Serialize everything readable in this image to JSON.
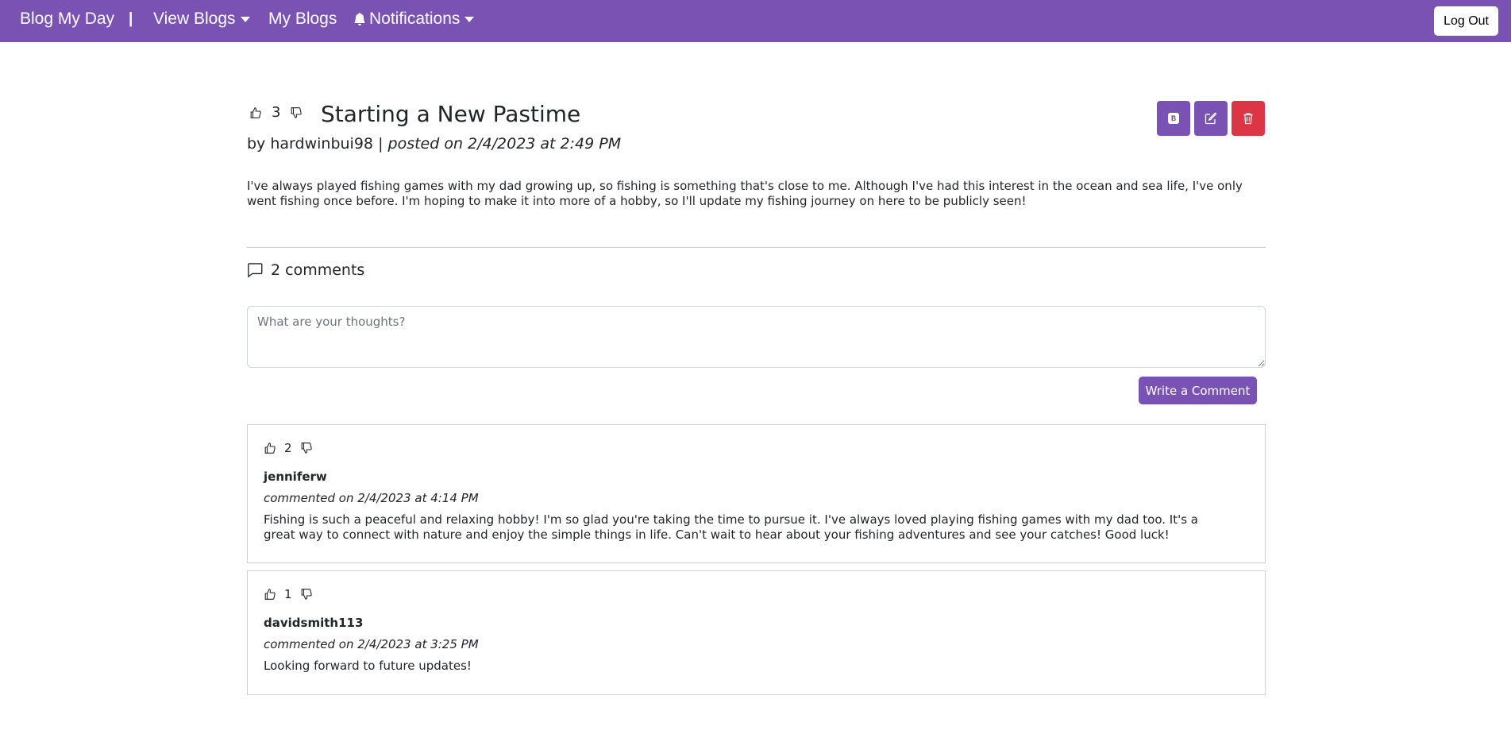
{
  "navbar": {
    "brand": "Blog My Day",
    "separator": "|",
    "view_blogs": "View Blogs",
    "my_blogs": "My Blogs",
    "notifications": "Notifications",
    "logout": "Log Out",
    "bg_color": "#7952b3"
  },
  "post": {
    "votes": "3",
    "title": "Starting a New Pastime",
    "author_prefix": "by",
    "author": "hardwinbui98",
    "byline_sep": "|",
    "posted": "posted on 2/4/2023 at 2:49 PM",
    "body": "I've always played fishing games with my dad growing up, so fishing is something that's close to me. Although I've had this interest in the ocean and sea life, I've only went fishing once before. I'm hoping to make it into more of a hobby, so I'll update my fishing journey on here to be publicly seen!",
    "actions": {
      "bold_icon": "bold-icon",
      "edit_icon": "edit-icon",
      "delete_icon": "trash-icon",
      "accent": "#7952b3",
      "danger": "#dc3545"
    }
  },
  "comments_section": {
    "count_label": "2 comments",
    "input_placeholder": "What are your thoughts?",
    "submit_label": "Write a Comment",
    "items": [
      {
        "votes": "2",
        "author": "jenniferw",
        "meta": "commented on 2/4/2023 at 4:14 PM",
        "text": "Fishing is such a peaceful and relaxing hobby! I'm so glad you're taking the time to pursue it. I've always loved playing fishing games with my dad too. It's a great way to connect with nature and enjoy the simple things in life. Can't wait to hear about your fishing adventures and see your catches! Good luck!"
      },
      {
        "votes": "1",
        "author": "davidsmith113",
        "meta": "commented on 2/4/2023 at 3:25 PM",
        "text": "Looking forward to future updates!"
      }
    ]
  }
}
